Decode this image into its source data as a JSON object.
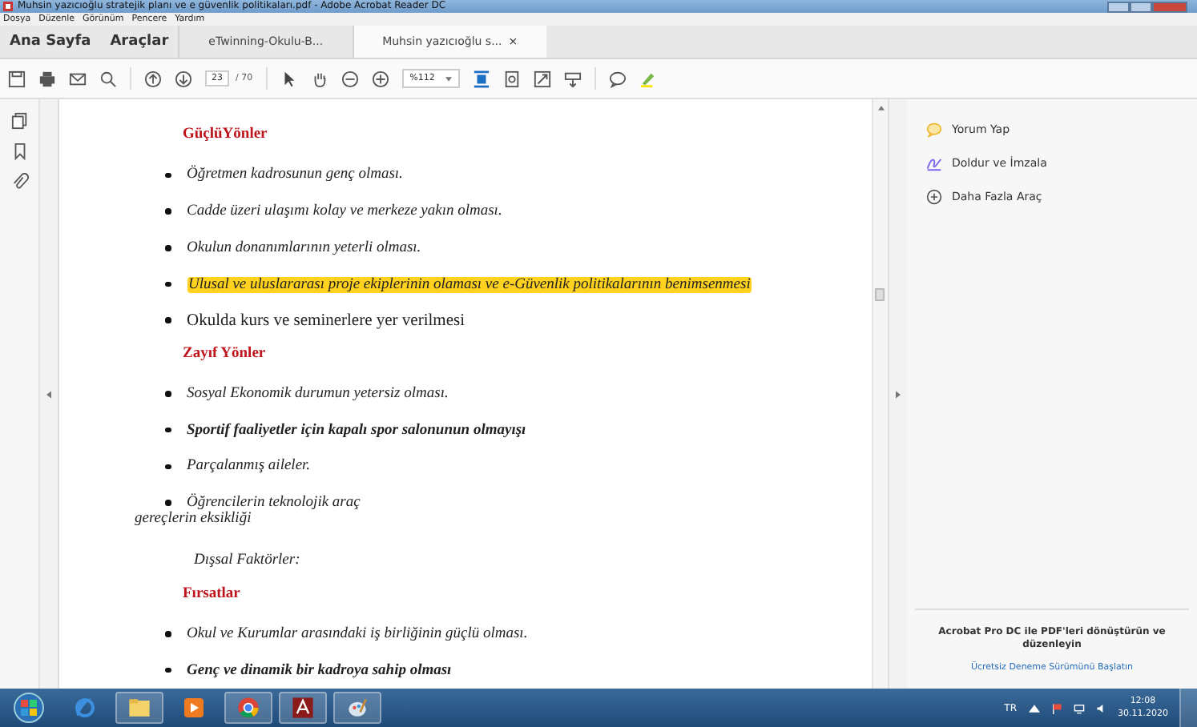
{
  "window": {
    "title": "Muhsin yazıcıoğlu stratejik planı ve e güvenlik politikaları.pdf - Adobe Acrobat Reader DC"
  },
  "menu": [
    "Dosya",
    "Düzenle",
    "Görünüm",
    "Pencere",
    "Yardım"
  ],
  "tabs": [
    {
      "label": "Ana Sayfa",
      "kind": "nav",
      "selected": false
    },
    {
      "label": "Araçlar",
      "kind": "nav",
      "selected": false
    },
    {
      "label": "eTwinning-Okulu-B...",
      "kind": "doc",
      "selected": false
    },
    {
      "label": "Muhsin yazıcıoğlu s...",
      "kind": "doc",
      "selected": true,
      "close": "×"
    }
  ],
  "toolbar": {
    "page": "23",
    "page_total": "/ 70",
    "zoom": "%112"
  },
  "document": [
    {
      "kind": "heading",
      "text": "GüçlüYönler"
    },
    {
      "kind": "bullet",
      "highlighted": false,
      "text": "Öğretmen kadrosunun genç olması."
    },
    {
      "kind": "bullet",
      "highlighted": false,
      "text": "Cadde üzeri ulaşımı kolay ve merkeze yakın olması."
    },
    {
      "kind": "bullet",
      "highlighted": false,
      "text": "Okulun donanımlarının yeterli olması."
    },
    {
      "kind": "bullet",
      "highlighted": true,
      "text": "Ulusal ve uluslararası proje ekiplerinin olaması ve e-Güvenlik politikalarının benimsenmesi"
    },
    {
      "kind": "plainbullet",
      "highlighted": false,
      "text": "Okulda kurs ve seminerlere yer verilmesi"
    },
    {
      "kind": "heading",
      "text": "Zayıf Yönler"
    },
    {
      "kind": "bullet",
      "highlighted": false,
      "text": "Sosyal Ekonomik durumun yetersiz olması."
    },
    {
      "kind": "boldbullet",
      "highlighted": false,
      "text": "Sportif faaliyetler için kapalı spor salonunun olmayışı"
    },
    {
      "kind": "bullet",
      "highlighted": false,
      "text": "Parçalanmış aileler."
    },
    {
      "kind": "bullet",
      "highlighted": false,
      "text": "Öğrencilerin teknolojik araç",
      "continuation": "gereçlerin eksikliği"
    },
    {
      "kind": "text",
      "text": "Dışsal Faktörler:"
    },
    {
      "kind": "heading",
      "text": "Fırsatlar"
    },
    {
      "kind": "bullet",
      "highlighted": false,
      "text": "Okul ve Kurumlar arasındaki iş birliğinin güçlü olması."
    },
    {
      "kind": "boldbullet",
      "highlighted": false,
      "text": "Genç ve dinamik bir kadroya sahip olması"
    }
  ],
  "right_panel": {
    "tools": [
      {
        "kind": "comment",
        "label": "Yorum Yap"
      },
      {
        "kind": "sign",
        "label": "Doldur ve İmzala"
      },
      {
        "kind": "more",
        "label": "Daha Fazla Araç"
      }
    ],
    "promo": "Acrobat Pro DC ile PDF'leri dönüştürün ve düzenleyin",
    "promo_link": "Ücretsiz Deneme Sürümünü Başlatın"
  },
  "taskbar": {
    "apps": [
      {
        "kind": "ie"
      },
      {
        "kind": "folder"
      },
      {
        "kind": "media"
      },
      {
        "kind": "chrome"
      },
      {
        "kind": "acrobat"
      },
      {
        "kind": "paint"
      }
    ],
    "language": "TR",
    "time": "12:08",
    "date": "30.11.2020"
  }
}
